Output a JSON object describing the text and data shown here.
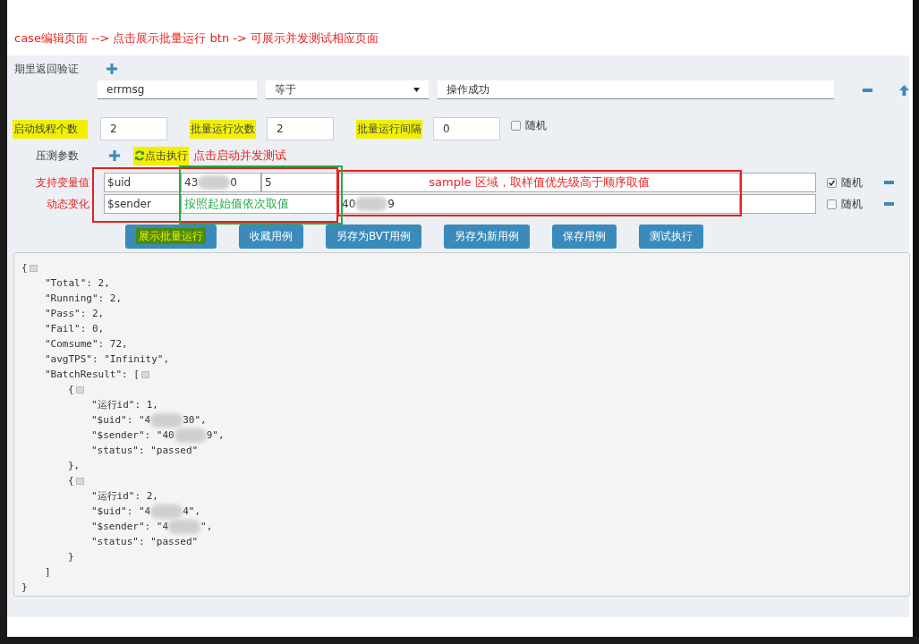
{
  "annotation_title": "case编辑页面 --> 点击展示批量运行 btn -> 可展示并发测试相应页面",
  "expect": {
    "label": "期里返回验证",
    "field": "errmsg",
    "operator": "等于",
    "value": "操作成功"
  },
  "settings": [
    {
      "label": "启动线程个数",
      "value": "2",
      "highlighted": true
    },
    {
      "label": "批量运行次数",
      "value": "2",
      "highlighted": true
    },
    {
      "label": "批量运行间隔",
      "value": "0",
      "highlighted": true
    }
  ],
  "settings_random": {
    "label": "随机",
    "checked": false
  },
  "pressure": {
    "label": "压测参数",
    "run_button": "点击执行",
    "run_highlighted": true,
    "hint": "点击启动并发测试"
  },
  "variable_rows": [
    {
      "label": "支持变量值",
      "cells": [
        {
          "kind": "value",
          "segments": [
            "$uid"
          ]
        },
        {
          "kind": "value",
          "segments": [
            "43",
            "0"
          ]
        },
        {
          "kind": "value",
          "segments": [
            "5"
          ]
        },
        {
          "kind": "note",
          "segments": [
            "sample 区域，取样值优先级高于顺序取值"
          ],
          "color": "#ee2222"
        },
        {
          "kind": "value"
        }
      ],
      "random": {
        "label": "随机",
        "checked": true
      }
    },
    {
      "label": "动态变化",
      "cells": [
        {
          "kind": "value",
          "segments": [
            "$sender"
          ]
        },
        {
          "kind": "note",
          "segments": [
            "按照起始值依次取值"
          ],
          "color": "#22aa44"
        },
        {
          "kind": "value",
          "segments": [
            "40",
            "9"
          ]
        },
        {
          "kind": "value"
        }
      ],
      "random": {
        "label": "随机",
        "checked": false
      }
    }
  ],
  "buttons": [
    {
      "label": "展示批量运行",
      "highlighted": true
    },
    {
      "label": "收藏用例",
      "highlighted": false
    },
    {
      "label": "另存为BVT用例",
      "highlighted": false
    },
    {
      "label": "另存为新用例",
      "highlighted": false
    },
    {
      "label": "保存用例",
      "highlighted": false
    },
    {
      "label": "测试执行",
      "highlighted": false
    }
  ],
  "output": {
    "open": "{",
    "expanded": true,
    "close": "}",
    "children": [
      {
        "segments": [
          "\"Total\": 2,"
        ]
      },
      {
        "segments": [
          "\"Running\": 2,"
        ]
      },
      {
        "segments": [
          "\"Pass\": 2,"
        ]
      },
      {
        "segments": [
          "\"Fail\": 0,"
        ]
      },
      {
        "segments": [
          "\"Comsume\": 72,"
        ]
      },
      {
        "segments": [
          "\"avgTPS\": \"Infinity\","
        ]
      },
      {
        "open": "\"BatchResult\": [",
        "expanded": true,
        "close": "]",
        "children": [
          {
            "open": "{",
            "expanded": true,
            "close": "},",
            "children": [
              {
                "segments": [
                  "\"运行id\": 1,"
                ]
              },
              {
                "segments": [
                  "\"$uid\": \"4",
                  "30\","
                ]
              },
              {
                "segments": [
                  "\"$sender\": \"40",
                  "9\","
                ]
              },
              {
                "segments": [
                  "\"status\": \"passed\""
                ]
              }
            ]
          },
          {
            "open": "{",
            "expanded": true,
            "close": "}",
            "children": [
              {
                "segments": [
                  "\"运行id\": 2,"
                ]
              },
              {
                "segments": [
                  "\"$uid\": \"4",
                  "4\","
                ]
              },
              {
                "segments": [
                  "\"$sender\": \"4",
                  "\","
                ]
              },
              {
                "segments": [
                  "\"status\": \"passed\""
                ]
              }
            ]
          }
        ]
      }
    ]
  }
}
